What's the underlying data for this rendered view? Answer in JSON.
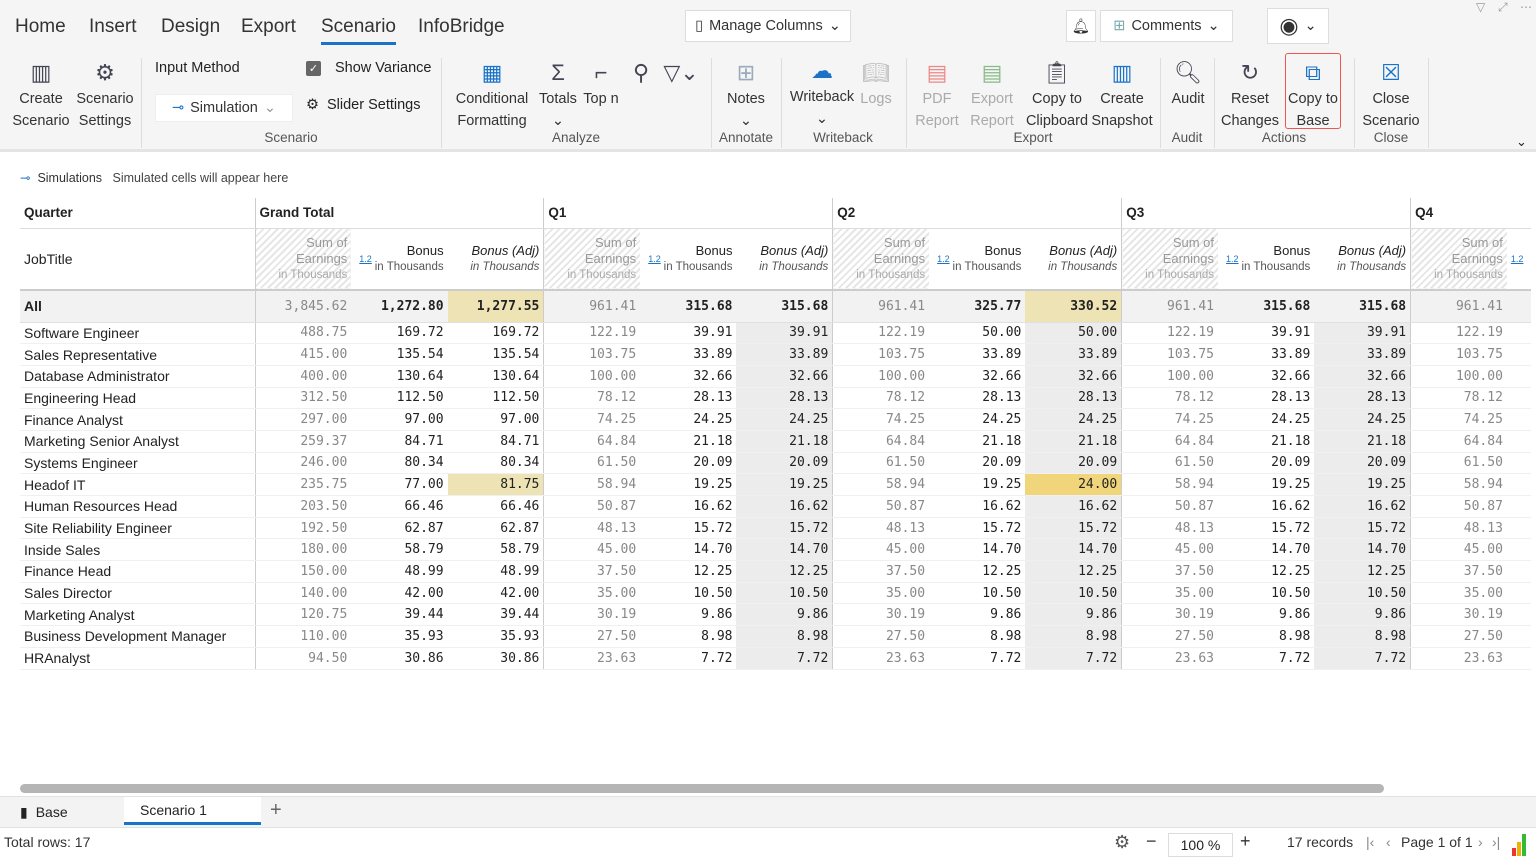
{
  "tabs": [
    "Home",
    "Insert",
    "Design",
    "Export",
    "Scenario",
    "InfoBridge"
  ],
  "active_tab": "Scenario",
  "manage_columns": "Manage Columns",
  "comments": "Comments",
  "ribbon": {
    "create_scenario": [
      "Create",
      "Scenario"
    ],
    "scenario_settings": [
      "Scenario",
      "Settings"
    ],
    "input_method": "Input Method",
    "input_method_value": "Simulation",
    "show_variance": "Show Variance",
    "show_variance_checked": true,
    "slider_settings": "Slider Settings",
    "conditional_formatting": [
      "Conditional",
      "Formatting"
    ],
    "totals": "Totals",
    "top_n": "Top n",
    "notes": "Notes",
    "writeback": "Writeback",
    "logs": "Logs",
    "pdf_report": [
      "PDF",
      "Report"
    ],
    "export_report": [
      "Export",
      "Report"
    ],
    "copy_clipboard": [
      "Copy to",
      "Clipboard"
    ],
    "create_snapshot": [
      "Create",
      "Snapshot"
    ],
    "audit": "Audit",
    "reset_changes": [
      "Reset",
      "Changes"
    ],
    "copy_to_base": [
      "Copy to",
      "Base"
    ],
    "close_scenario": [
      "Close",
      "Scenario"
    ],
    "groups": {
      "scenario": "Scenario",
      "analyze": "Analyze",
      "annotate": "Annotate",
      "writeback": "Writeback",
      "export": "Export",
      "audit": "Audit",
      "actions": "Actions",
      "close": "Close"
    }
  },
  "legend": {
    "label": "Simulations",
    "text": "Simulated cells will appear here"
  },
  "table": {
    "corner_top": "Quarter",
    "corner_bottom": "JobTitle",
    "groups": [
      "Grand Total",
      "Q1",
      "Q2",
      "Q3",
      "Q4"
    ],
    "col_headers": {
      "sum": [
        "Sum of",
        "Earnings",
        "in Thousands"
      ],
      "bonus": [
        "Bonus",
        "in Thousands"
      ],
      "adj": [
        "Bonus (Adj)",
        "in Thousands"
      ],
      "variance_icon": "1.2"
    },
    "rows": [
      [
        "All",
        "3,845.62",
        "1,272.80",
        "1,277.55",
        "961.41",
        "315.68",
        "315.68",
        "961.41",
        "325.77",
        "330.52",
        "961.41",
        "315.68",
        "315.68",
        "961.41"
      ],
      [
        "Software Engineer",
        "488.75",
        "169.72",
        "169.72",
        "122.19",
        "39.91",
        "39.91",
        "122.19",
        "50.00",
        "50.00",
        "122.19",
        "39.91",
        "39.91",
        "122.19"
      ],
      [
        "Sales Representative",
        "415.00",
        "135.54",
        "135.54",
        "103.75",
        "33.89",
        "33.89",
        "103.75",
        "33.89",
        "33.89",
        "103.75",
        "33.89",
        "33.89",
        "103.75"
      ],
      [
        "Database Administrator",
        "400.00",
        "130.64",
        "130.64",
        "100.00",
        "32.66",
        "32.66",
        "100.00",
        "32.66",
        "32.66",
        "100.00",
        "32.66",
        "32.66",
        "100.00"
      ],
      [
        "Engineering Head",
        "312.50",
        "112.50",
        "112.50",
        "78.12",
        "28.13",
        "28.13",
        "78.12",
        "28.13",
        "28.13",
        "78.12",
        "28.13",
        "28.13",
        "78.12"
      ],
      [
        "Finance Analyst",
        "297.00",
        "97.00",
        "97.00",
        "74.25",
        "24.25",
        "24.25",
        "74.25",
        "24.25",
        "24.25",
        "74.25",
        "24.25",
        "24.25",
        "74.25"
      ],
      [
        "Marketing Senior Analyst",
        "259.37",
        "84.71",
        "84.71",
        "64.84",
        "21.18",
        "21.18",
        "64.84",
        "21.18",
        "21.18",
        "64.84",
        "21.18",
        "21.18",
        "64.84"
      ],
      [
        "Systems Engineer",
        "246.00",
        "80.34",
        "80.34",
        "61.50",
        "20.09",
        "20.09",
        "61.50",
        "20.09",
        "20.09",
        "61.50",
        "20.09",
        "20.09",
        "61.50"
      ],
      [
        "Headof IT",
        "235.75",
        "77.00",
        "81.75",
        "58.94",
        "19.25",
        "19.25",
        "58.94",
        "19.25",
        "24.00",
        "58.94",
        "19.25",
        "19.25",
        "58.94"
      ],
      [
        "Human Resources Head",
        "203.50",
        "66.46",
        "66.46",
        "50.87",
        "16.62",
        "16.62",
        "50.87",
        "16.62",
        "16.62",
        "50.87",
        "16.62",
        "16.62",
        "50.87"
      ],
      [
        "Site Reliability Engineer",
        "192.50",
        "62.87",
        "62.87",
        "48.13",
        "15.72",
        "15.72",
        "48.13",
        "15.72",
        "15.72",
        "48.13",
        "15.72",
        "15.72",
        "48.13"
      ],
      [
        "Inside Sales",
        "180.00",
        "58.79",
        "58.79",
        "45.00",
        "14.70",
        "14.70",
        "45.00",
        "14.70",
        "14.70",
        "45.00",
        "14.70",
        "14.70",
        "45.00"
      ],
      [
        "Finance Head",
        "150.00",
        "48.99",
        "48.99",
        "37.50",
        "12.25",
        "12.25",
        "37.50",
        "12.25",
        "12.25",
        "37.50",
        "12.25",
        "12.25",
        "37.50"
      ],
      [
        "Sales Director",
        "140.00",
        "42.00",
        "42.00",
        "35.00",
        "10.50",
        "10.50",
        "35.00",
        "10.50",
        "10.50",
        "35.00",
        "10.50",
        "10.50",
        "35.00"
      ],
      [
        "Marketing Analyst",
        "120.75",
        "39.44",
        "39.44",
        "30.19",
        "9.86",
        "9.86",
        "30.19",
        "9.86",
        "9.86",
        "30.19",
        "9.86",
        "9.86",
        "30.19"
      ],
      [
        "Business Development Manager",
        "110.00",
        "35.93",
        "35.93",
        "27.50",
        "8.98",
        "8.98",
        "27.50",
        "8.98",
        "8.98",
        "27.50",
        "8.98",
        "8.98",
        "27.50"
      ],
      [
        "HRAnalyst",
        "94.50",
        "30.86",
        "30.86",
        "23.63",
        "7.72",
        "7.72",
        "23.63",
        "7.72",
        "7.72",
        "23.63",
        "7.72",
        "7.72",
        "23.63"
      ]
    ],
    "highlight": {
      "edited": "#f0d57a",
      "affected": "#ede3b5"
    }
  },
  "sheet_tabs": {
    "base": "Base",
    "scenario": "Scenario 1"
  },
  "status": {
    "total_rows": "Total rows: 17",
    "zoom": "100 %",
    "records": "17 records",
    "page": "Page 1 of 1"
  }
}
